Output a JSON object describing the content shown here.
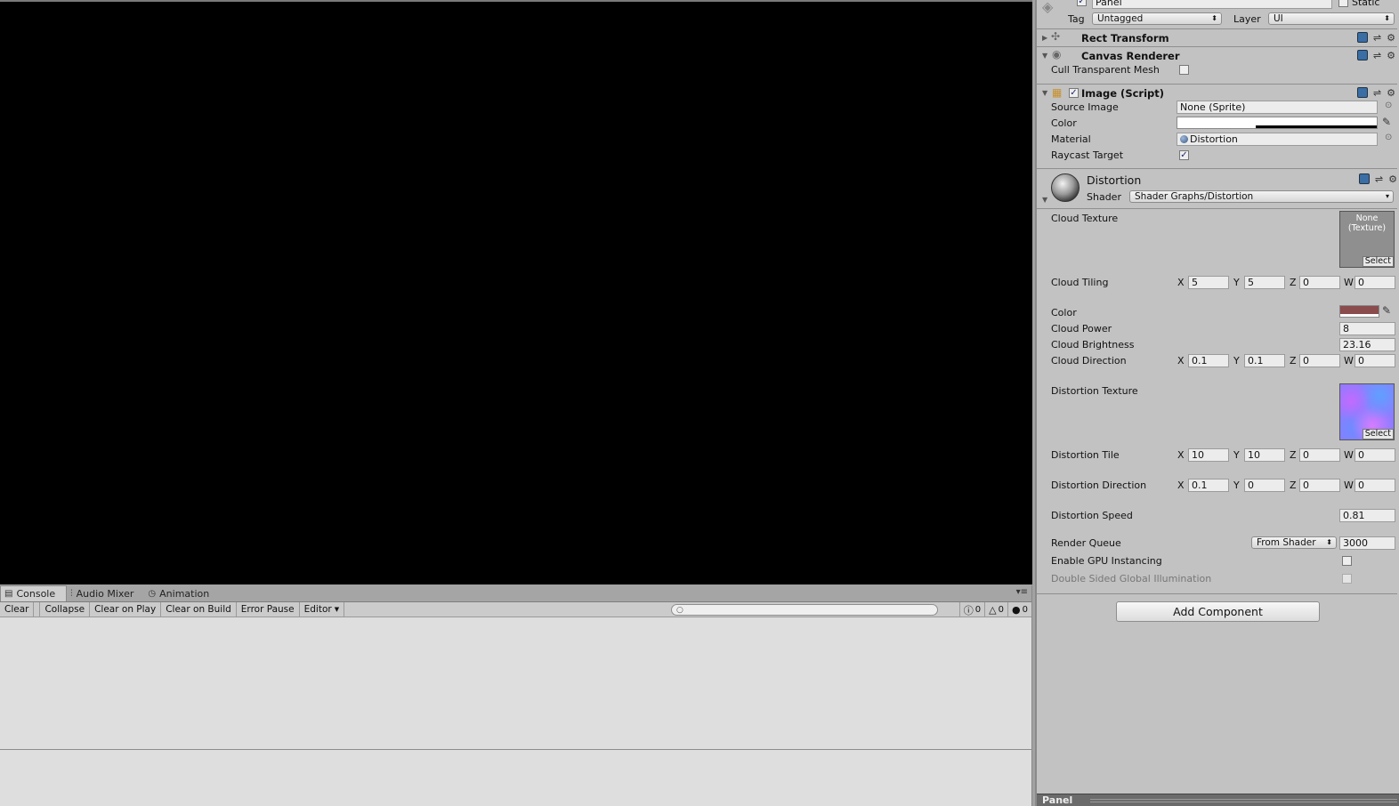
{
  "console": {
    "tabs": [
      {
        "label": "Console",
        "icon": "console-icon"
      },
      {
        "label": "Audio Mixer",
        "icon": "audio-mixer-icon"
      },
      {
        "label": "Animation",
        "icon": "animation-clock-icon"
      }
    ],
    "toolbar": {
      "clear": "Clear",
      "collapse": "Collapse",
      "clear_on_play": "Clear on Play",
      "clear_on_build": "Clear on Build",
      "error_pause": "Error Pause",
      "editor": "Editor"
    },
    "counts": {
      "info": "0",
      "warning": "0",
      "error": "0"
    }
  },
  "inspector": {
    "object_name": "Panel",
    "static_label": "Static",
    "tag_label": "Tag",
    "tag_value": "Untagged",
    "layer_label": "Layer",
    "layer_value": "UI",
    "rect_transform": "Rect Transform",
    "canvas_renderer": {
      "title": "Canvas Renderer",
      "cull_label": "Cull Transparent Mesh"
    },
    "image_script": {
      "title": "Image (Script)",
      "source_image_label": "Source Image",
      "source_image_value": "None (Sprite)",
      "color_label": "Color",
      "material_label": "Material",
      "material_value": "Distortion",
      "raycast_label": "Raycast Target"
    },
    "material": {
      "name": "Distortion",
      "shader_label": "Shader",
      "shader_value": "Shader Graphs/Distortion",
      "cloud_texture_label": "Cloud Texture",
      "cloud_texture_value": "None\n(Texture)",
      "select_label": "Select",
      "cloud_tiling_label": "Cloud Tiling",
      "cloud_tiling": {
        "x": "5",
        "y": "5",
        "z": "0",
        "w": "0"
      },
      "color_label": "Color",
      "color_hex": "#8a4c4c",
      "cloud_power_label": "Cloud Power",
      "cloud_power": "8",
      "cloud_brightness_label": "Cloud Brightness",
      "cloud_brightness": "23.16",
      "cloud_direction_label": "Cloud Direction",
      "cloud_direction": {
        "x": "0.1",
        "y": "0.1",
        "z": "0",
        "w": "0"
      },
      "distortion_texture_label": "Distortion Texture",
      "distortion_tile_label": "Distortion Tile",
      "distortion_tile": {
        "x": "10",
        "y": "10",
        "z": "0",
        "w": "0"
      },
      "distortion_direction_label": "Distortion Direction",
      "distortion_direction": {
        "x": "0.1",
        "y": "0",
        "z": "0",
        "w": "0"
      },
      "distortion_speed_label": "Distortion Speed",
      "distortion_speed": "0.81",
      "render_queue_label": "Render Queue",
      "render_queue_mode": "From Shader",
      "render_queue_value": "3000",
      "gpu_instancing_label": "Enable GPU Instancing",
      "double_sided_gi_label": "Double Sided Global Illumination"
    },
    "add_component": "Add Component",
    "footer_title": "Panel"
  },
  "axis_labels": {
    "x": "X",
    "y": "Y",
    "z": "Z",
    "w": "W"
  }
}
